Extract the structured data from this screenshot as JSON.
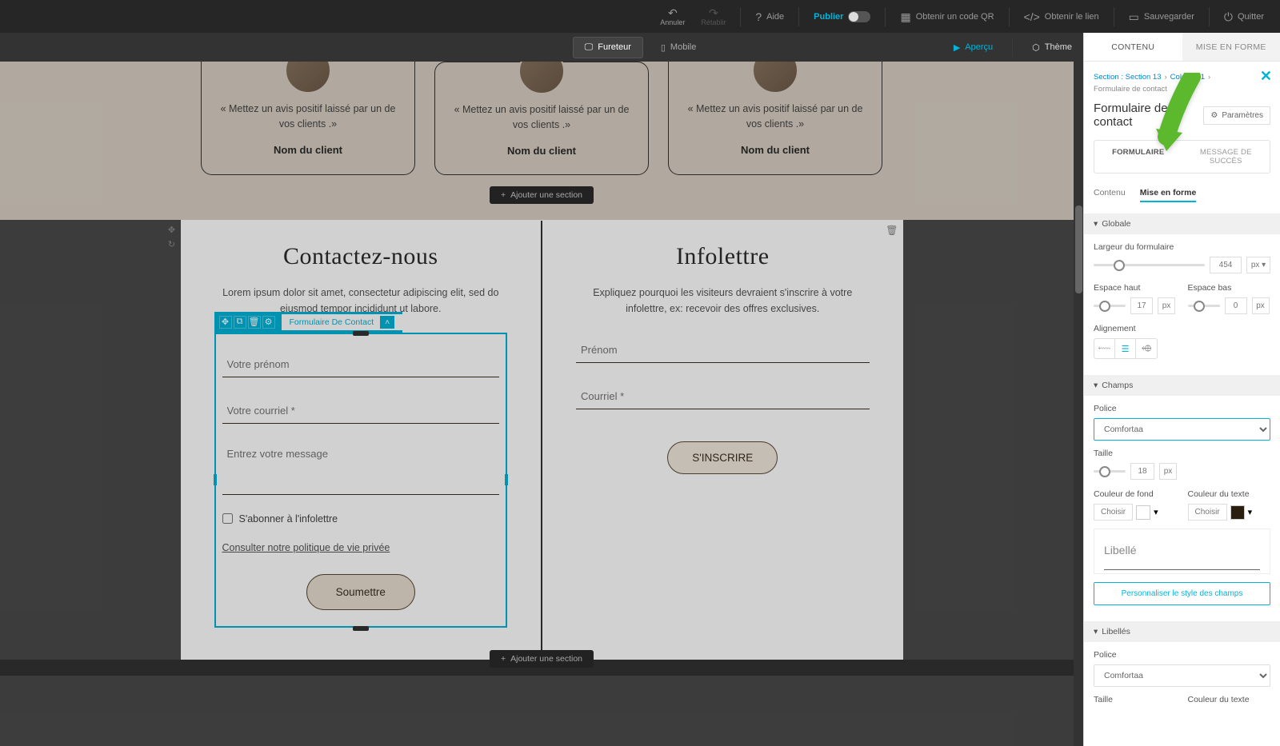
{
  "toolbar": {
    "annuler": "Annuler",
    "retablir": "Rétablir",
    "aide": "Aide",
    "publier": "Publier",
    "qr": "Obtenir un code QR",
    "lien": "Obtenir le lien",
    "save": "Sauvegarder",
    "quitter": "Quitter"
  },
  "device": {
    "fureteur": "Fureteur",
    "mobile": "Mobile",
    "apercu": "Aperçu",
    "theme": "Thème"
  },
  "addSection": "Ajouter une section",
  "testimonials": {
    "quote": "« Mettez un avis positif laissé par un de vos clients .»",
    "name": "Nom du client"
  },
  "contact": {
    "title": "Contactez-nous",
    "desc": "Lorem ipsum dolor sit amet, consectetur adipiscing elit, sed do eiusmod tempor incididunt ut labore.",
    "selectedLabel": "Formulaire De Contact",
    "prenom": "Votre prénom",
    "courriel": "Votre courriel *",
    "message": "Entrez votre message",
    "abo": "S'abonner à l'infolettre",
    "policy": "Consulter notre politique de vie privée",
    "submit": "Soumettre"
  },
  "infolettre": {
    "title": "Infolettre",
    "desc": "Expliquez pourquoi les visiteurs devraient s'inscrire à votre infolettre, ex: recevoir des offres exclusives.",
    "prenom": "Prénom",
    "courriel": "Courriel *",
    "submit": "S'INSCRIRE"
  },
  "panel": {
    "tabs": {
      "contenu": "CONTENU",
      "mef": "MISE EN FORME"
    },
    "crumb": {
      "a": "Section : Section 13",
      "b": "Colonne 1",
      "c": "Formulaire de contact"
    },
    "title": "Formulaire de contact",
    "settings": "Paramètres",
    "seg": {
      "formulaire": "FORMULAIRE",
      "succes": "MESSAGE DE SUCCÈS"
    },
    "sub": {
      "contenu": "Contenu",
      "mef": "Mise en forme"
    },
    "globale": "Globale",
    "largeur": "Largeur du formulaire",
    "largeurVal": "454",
    "px": "px",
    "espaceHaut": "Espace haut",
    "espaceHautVal": "17",
    "espaceBas": "Espace bas",
    "espaceBasVal": "0",
    "alignement": "Alignement",
    "champs": "Champs",
    "police": "Police",
    "policeVal": "Comfortaa",
    "taille": "Taille",
    "tailleVal": "18",
    "cfond": "Couleur de fond",
    "ctexte": "Couleur du texte",
    "choisir": "Choisir",
    "libelle": "Libellé",
    "personnaliser": "Personnaliser le style des champs",
    "libelles": "Libellés"
  }
}
